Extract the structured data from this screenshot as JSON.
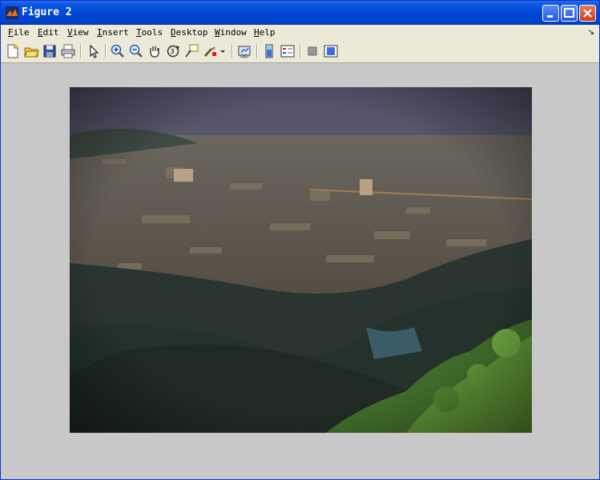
{
  "window": {
    "title": "Figure 2"
  },
  "menu": [
    {
      "label": "File",
      "u": "F",
      "rest": "ile"
    },
    {
      "label": "Edit",
      "u": "E",
      "rest": "dit"
    },
    {
      "label": "View",
      "u": "V",
      "rest": "iew"
    },
    {
      "label": "Insert",
      "u": "I",
      "rest": "nsert"
    },
    {
      "label": "Tools",
      "u": "T",
      "rest": "ools"
    },
    {
      "label": "Desktop",
      "u": "D",
      "rest": "esktop"
    },
    {
      "label": "Window",
      "u": "W",
      "rest": "indow"
    },
    {
      "label": "Help",
      "u": "H",
      "rest": "elp"
    }
  ],
  "toolbar": {
    "icons": [
      "new-figure-icon",
      "open-file-icon",
      "save-icon",
      "print-icon",
      "edit-plot-arrow-icon",
      "zoom-in-icon",
      "zoom-out-icon",
      "pan-hand-icon",
      "rotate-3d-icon",
      "data-cursor-icon",
      "brush-icon",
      "brush-dropdown-icon",
      "link-plot-icon",
      "colorbar-icon",
      "legend-icon",
      "hide-plot-tools-icon",
      "show-plot-tools-icon"
    ]
  },
  "figure": {
    "content": "landscape photo of a city valley seen from a mountain",
    "colors": {
      "sky": "#6b6a78",
      "city": "#5e5648",
      "hills": "#26352f",
      "trees": "#4f7e2c",
      "background": "#c8c8c8"
    }
  }
}
